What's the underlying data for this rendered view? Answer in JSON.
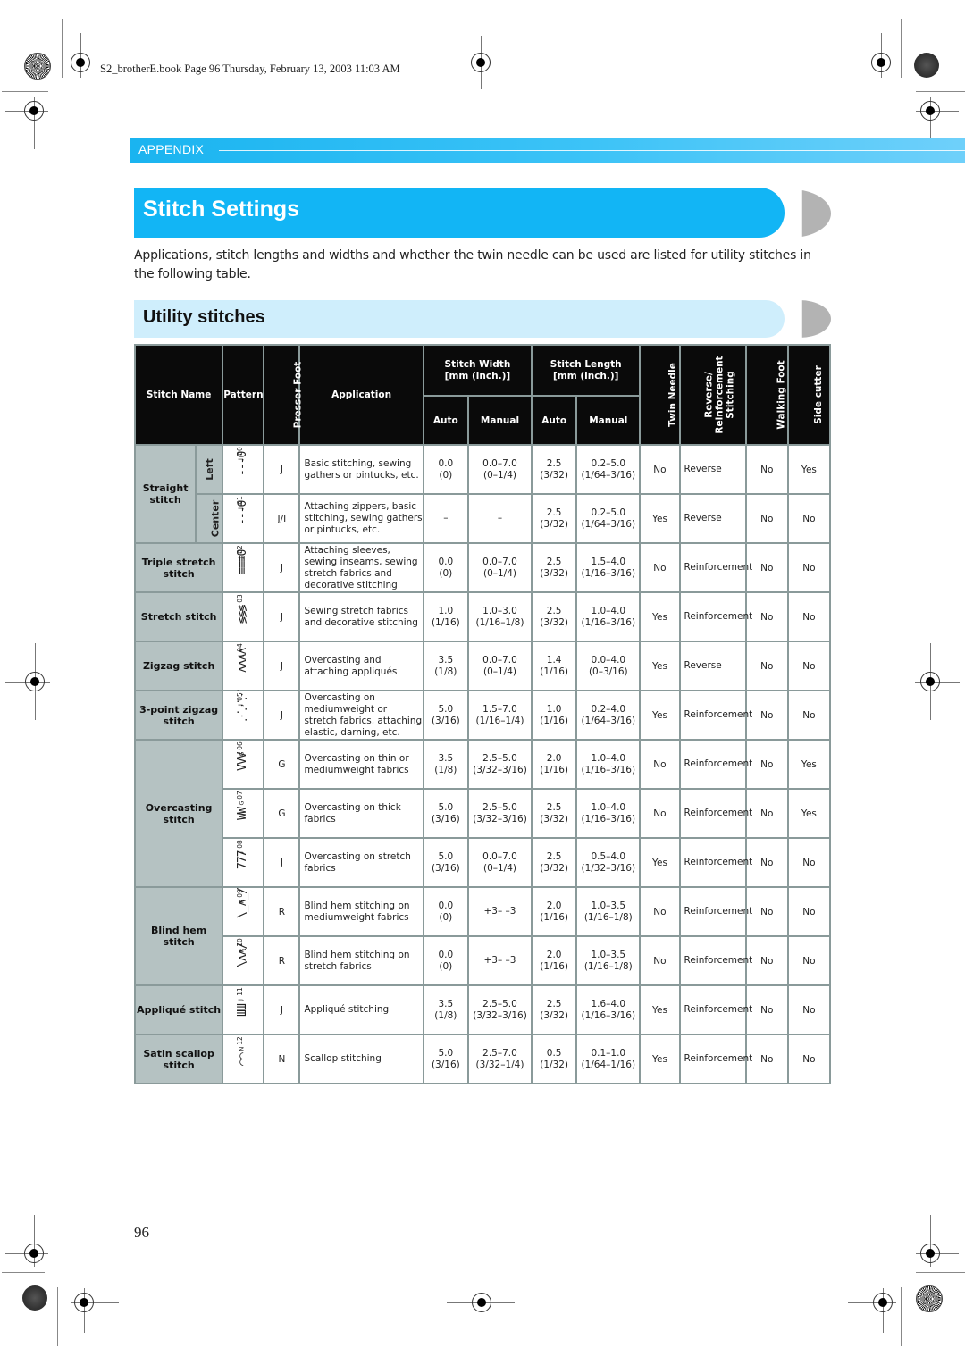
{
  "print_info": "S2_brotherE.book  Page 96  Thursday, February 13, 2003  11:03 AM",
  "section_label": "APPENDIX",
  "page_title": "Stitch Settings",
  "intro_text": "Applications, stitch lengths and widths and whether the twin needle can be used are listed for utility stitches in the following table.",
  "subsection_title": "Utility stitches",
  "page_number": "96",
  "colors": {
    "section_bar": "#1ab4f0",
    "title_bar": "#12b5f5",
    "subtitle_bar": "#cfeefc",
    "header_bg": "#0a0a0a",
    "name_cell_bg": "#b5c2c2"
  },
  "table": {
    "headers": {
      "stitch_name": "Stitch Name",
      "pattern": "Pattern",
      "presser_foot": "Presser Foot",
      "application": "Application",
      "stitch_width": "Stitch Width",
      "stitch_width_unit": "[mm (inch.)]",
      "stitch_length": "Stitch Length",
      "stitch_length_unit": "[mm (inch.)]",
      "auto": "Auto",
      "manual": "Manual",
      "twin_needle": "Twin Needle",
      "reverse_l1": "Reverse/",
      "reverse_l2": "Reinforcement",
      "reverse_l3": "Stitching",
      "walking_foot": "Walking Foot",
      "side_cutter": "Side cutter"
    },
    "groups": [
      {
        "name": "Straight stitch",
        "subs": [
          "Left",
          "Center"
        ]
      },
      {
        "name": "Triple stretch stitch"
      },
      {
        "name": "Stretch stitch"
      },
      {
        "name": "Zigzag stitch"
      },
      {
        "name": "3-point zigzag stitch"
      },
      {
        "name": "Overcasting stitch"
      },
      {
        "name": "Blind hem stitch"
      },
      {
        "name": "Appliqué stitch"
      },
      {
        "name": "Satin scallop stitch"
      }
    ],
    "rows": [
      {
        "pattern_no": "00",
        "pattern_foot": "J",
        "glyph": "---0",
        "foot": "J",
        "application": "Basic stitching, sewing gathers or pintucks, etc.",
        "w_auto": "0.0",
        "w_auto_in": "(0)",
        "w_man": "0.0–7.0",
        "w_man_in": "(0–1/4)",
        "l_auto": "2.5",
        "l_auto_in": "(3/32)",
        "l_man": "0.2–5.0",
        "l_man_in": "(1/64–3/16)",
        "twin": "No",
        "reverse": "Reverse",
        "walking": "No",
        "cutter": "Yes"
      },
      {
        "pattern_no": "01",
        "pattern_foot": "J",
        "glyph": "---θ",
        "foot": "J/I",
        "application": "Attaching zippers, basic stitching, sewing gathers or pintucks, etc.",
        "w_auto": "–",
        "w_auto_in": "",
        "w_man": "–",
        "w_man_in": "",
        "l_auto": "2.5",
        "l_auto_in": "(3/32)",
        "l_man": "0.2–5.0",
        "l_man_in": "(1/64–3/16)",
        "twin": "Yes",
        "reverse": "Reverse",
        "walking": "No",
        "cutter": "No"
      },
      {
        "pattern_no": "02",
        "pattern_foot": "J",
        "glyph": "≡≡≡0",
        "foot": "J",
        "application": "Attaching sleeves, sewing inseams, sewing stretch fabrics and decorative stitching",
        "w_auto": "0.0",
        "w_auto_in": "(0)",
        "w_man": "0.0–7.0",
        "w_man_in": "(0–1/4)",
        "l_auto": "2.5",
        "l_auto_in": "(3/32)",
        "l_man": "1.5–4.0",
        "l_man_in": "(1/16–3/16)",
        "twin": "No",
        "reverse": "Reinforcement",
        "walking": "No",
        "cutter": "No"
      },
      {
        "pattern_no": "03",
        "pattern_foot": "J",
        "glyph": "≶≶≶",
        "foot": "J",
        "application": "Sewing stretch fabrics and decorative stitching",
        "w_auto": "1.0",
        "w_auto_in": "(1/16)",
        "w_man": "1.0–3.0",
        "w_man_in": "(1/16–1/8)",
        "l_auto": "2.5",
        "l_auto_in": "(3/32)",
        "l_man": "1.0–4.0",
        "l_man_in": "(1/16–3/16)",
        "twin": "Yes",
        "reverse": "Reinforcement",
        "walking": "No",
        "cutter": "No"
      },
      {
        "pattern_no": "04",
        "pattern_foot": "J",
        "glyph": "ʌʌʌʌ",
        "foot": "J",
        "application": "Overcasting and attaching appliqués",
        "w_auto": "3.5",
        "w_auto_in": "(1/8)",
        "w_man": "0.0–7.0",
        "w_man_in": "(0–1/4)",
        "l_auto": "1.4",
        "l_auto_in": "(1/16)",
        "l_man": "0.0–4.0",
        "l_man_in": "(0–3/16)",
        "twin": "Yes",
        "reverse": "Reverse",
        "walking": "No",
        "cutter": "No"
      },
      {
        "pattern_no": "05",
        "pattern_foot": "J",
        "glyph": "⋰⋰⋰",
        "foot": "J",
        "application": "Overcasting on mediumweight or stretch fabrics, attaching elastic, darning, etc.",
        "w_auto": "5.0",
        "w_auto_in": "(3/16)",
        "w_man": "1.5–7.0",
        "w_man_in": "(1/16–1/4)",
        "l_auto": "1.0",
        "l_auto_in": "(1/16)",
        "l_man": "0.2–4.0",
        "l_man_in": "(1/64–3/16)",
        "twin": "Yes",
        "reverse": "Reinforcement",
        "walking": "No",
        "cutter": "No"
      },
      {
        "pattern_no": "06",
        "pattern_foot": "G",
        "glyph": "VVV",
        "foot": "G",
        "application": "Overcasting on thin or mediumweight fabrics",
        "w_auto": "3.5",
        "w_auto_in": "(1/8)",
        "w_man": "2.5–5.0",
        "w_man_in": "(3/32–3/16)",
        "l_auto": "2.0",
        "l_auto_in": "(1/16)",
        "l_man": "1.0–4.0",
        "l_man_in": "(1/16–3/16)",
        "twin": "No",
        "reverse": "Reinforcement",
        "walking": "No",
        "cutter": "Yes"
      },
      {
        "pattern_no": "07",
        "pattern_foot": "G",
        "glyph": "WW",
        "foot": "G",
        "application": "Overcasting on thick fabrics",
        "w_auto": "5.0",
        "w_auto_in": "(3/16)",
        "w_man": "2.5–5.0",
        "w_man_in": "(3/32–3/16)",
        "l_auto": "2.5",
        "l_auto_in": "(3/32)",
        "l_man": "1.0–4.0",
        "l_man_in": "(1/16–3/16)",
        "twin": "No",
        "reverse": "Reinforcement",
        "walking": "No",
        "cutter": "Yes"
      },
      {
        "pattern_no": "08",
        "pattern_foot": "J",
        "glyph": "777",
        "foot": "J",
        "application": "Overcasting on stretch fabrics",
        "w_auto": "5.0",
        "w_auto_in": "(3/16)",
        "w_man": "0.0–7.0",
        "w_man_in": "(0–1/4)",
        "l_auto": "2.5",
        "l_auto_in": "(3/32)",
        "l_man": "0.5–4.0",
        "l_man_in": "(1/32–3/16)",
        "twin": "Yes",
        "reverse": "Reinforcement",
        "walking": "No",
        "cutter": "No"
      },
      {
        "pattern_no": "09",
        "pattern_foot": "R",
        "glyph": "\\_ʌ_/",
        "foot": "R",
        "application": "Blind hem stitching on mediumweight fabrics",
        "w_auto": "0.0",
        "w_auto_in": "(0)",
        "w_man": "+3– –3",
        "w_man_in": "",
        "l_auto": "2.0",
        "l_auto_in": "(1/16)",
        "l_man": "1.0–3.5",
        "l_man_in": "(1/16–1/8)",
        "twin": "No",
        "reverse": "Reinforcement",
        "walking": "No",
        "cutter": "No"
      },
      {
        "pattern_no": "10",
        "pattern_foot": "R",
        "glyph": "\\ʌʌ/",
        "foot": "R",
        "application": "Blind hem stitching on stretch fabrics",
        "w_auto": "0.0",
        "w_auto_in": "(0)",
        "w_man": "+3– –3",
        "w_man_in": "",
        "l_auto": "2.0",
        "l_auto_in": "(1/16)",
        "l_man": "1.0–3.5",
        "l_man_in": "(1/16–1/8)",
        "twin": "No",
        "reverse": "Reinforcement",
        "walking": "No",
        "cutter": "No"
      },
      {
        "pattern_no": "11",
        "pattern_foot": "J",
        "glyph": "ШШ",
        "foot": "J",
        "application": "Appliqué stitching",
        "w_auto": "3.5",
        "w_auto_in": "(1/8)",
        "w_man": "2.5–5.0",
        "w_man_in": "(3/32–3/16)",
        "l_auto": "2.5",
        "l_auto_in": "(3/32)",
        "l_man": "1.6–4.0",
        "l_man_in": "(1/16–3/16)",
        "twin": "Yes",
        "reverse": "Reinforcement",
        "walking": "No",
        "cutter": "No"
      },
      {
        "pattern_no": "12",
        "pattern_foot": "N",
        "glyph": "⌒⌒",
        "foot": "N",
        "application": "Scallop stitching",
        "w_auto": "5.0",
        "w_auto_in": "(3/16)",
        "w_man": "2.5–7.0",
        "w_man_in": "(3/32–1/4)",
        "l_auto": "0.5",
        "l_auto_in": "(1/32)",
        "l_man": "0.1–1.0",
        "l_man_in": "(1/64–1/16)",
        "twin": "Yes",
        "reverse": "Reinforcement",
        "walking": "No",
        "cutter": "No"
      }
    ]
  }
}
